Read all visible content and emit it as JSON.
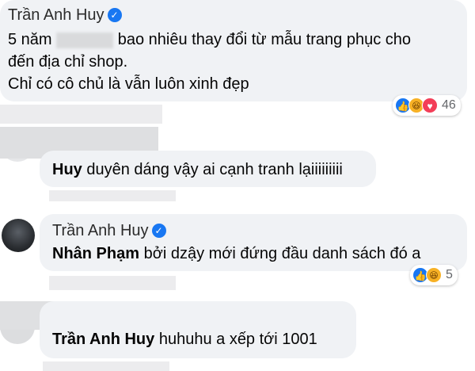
{
  "comments": [
    {
      "author": "Trần Anh Huy",
      "verified": true,
      "lines": [
        "5 năm",
        "bao nhiêu thay đổi từ mẫu trang phục cho",
        "đến địa chỉ shop.",
        "Chỉ có cô chủ là vẫn luôn xinh đẹp"
      ],
      "reaction_count": "46",
      "reactions": [
        "like-icon",
        "haha-icon",
        "love-icon"
      ]
    },
    {
      "mention": "Huy",
      "text": " duyên dáng vậy ai cạnh tranh lạiiiiiiiii"
    },
    {
      "author": "Trần Anh Huy",
      "verified": true,
      "mention": "Nhân Phạm",
      "text": " bởi dzậy mới đứng đầu danh sách đó a",
      "reaction_count": "5",
      "reactions": [
        "like-icon",
        "haha-icon"
      ]
    },
    {
      "mention": "Trần Anh Huy",
      "text": " huhuhu a xếp tới 1001"
    }
  ],
  "colors": {
    "bubble": "#f0f2f5",
    "like": "#1877f2",
    "love": "#f33e58",
    "haha": "#f7b125"
  }
}
